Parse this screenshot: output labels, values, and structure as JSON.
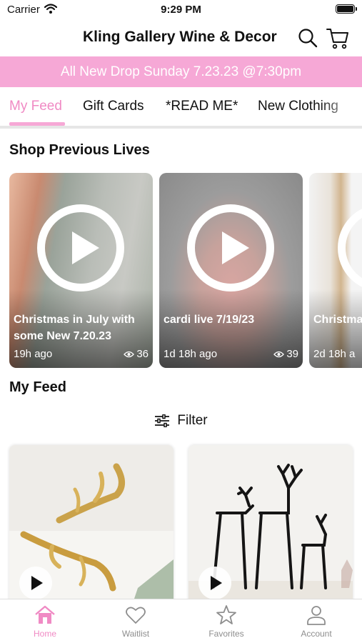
{
  "status_bar": {
    "carrier": "Carrier",
    "time": "9:29 PM"
  },
  "header": {
    "title": "Kling Gallery Wine & Decor",
    "search_icon": "search-icon",
    "cart_icon": "cart-icon"
  },
  "banner": {
    "text": "All New Drop Sunday 7.23.23 @7:30pm",
    "color": "#f6a8d6"
  },
  "tabs": [
    {
      "label": "My Feed",
      "active": true
    },
    {
      "label": "Gift Cards",
      "active": false
    },
    {
      "label": "*READ ME*",
      "active": false
    },
    {
      "label": "New Clothing",
      "active": false
    }
  ],
  "previous_lives": {
    "title": "Shop Previous Lives",
    "items": [
      {
        "title": "Christmas in July with some New 7.20.23",
        "age": "19h ago",
        "views": "36"
      },
      {
        "title": "cardi live 7/19/23",
        "age": "1d 18h ago",
        "views": "39"
      },
      {
        "title": "Christmas in July! Orn",
        "age": "2d 18h a",
        "views": ""
      }
    ]
  },
  "feed": {
    "title": "My Feed",
    "filter_label": "Filter",
    "items": [
      {
        "image": "gold-antlers-image"
      },
      {
        "image": "black-reindeer-sculptures-image"
      }
    ]
  },
  "bottom_nav": [
    {
      "label": "Home",
      "icon": "home-icon",
      "active": true
    },
    {
      "label": "Waitlist",
      "icon": "heart-icon",
      "active": false
    },
    {
      "label": "Favorites",
      "icon": "star-icon",
      "active": false
    },
    {
      "label": "Account",
      "icon": "person-icon",
      "active": false
    }
  ],
  "colors": {
    "accent": "#f08ac4",
    "banner": "#f6a8d6",
    "inactive": "#8e8e8e"
  }
}
